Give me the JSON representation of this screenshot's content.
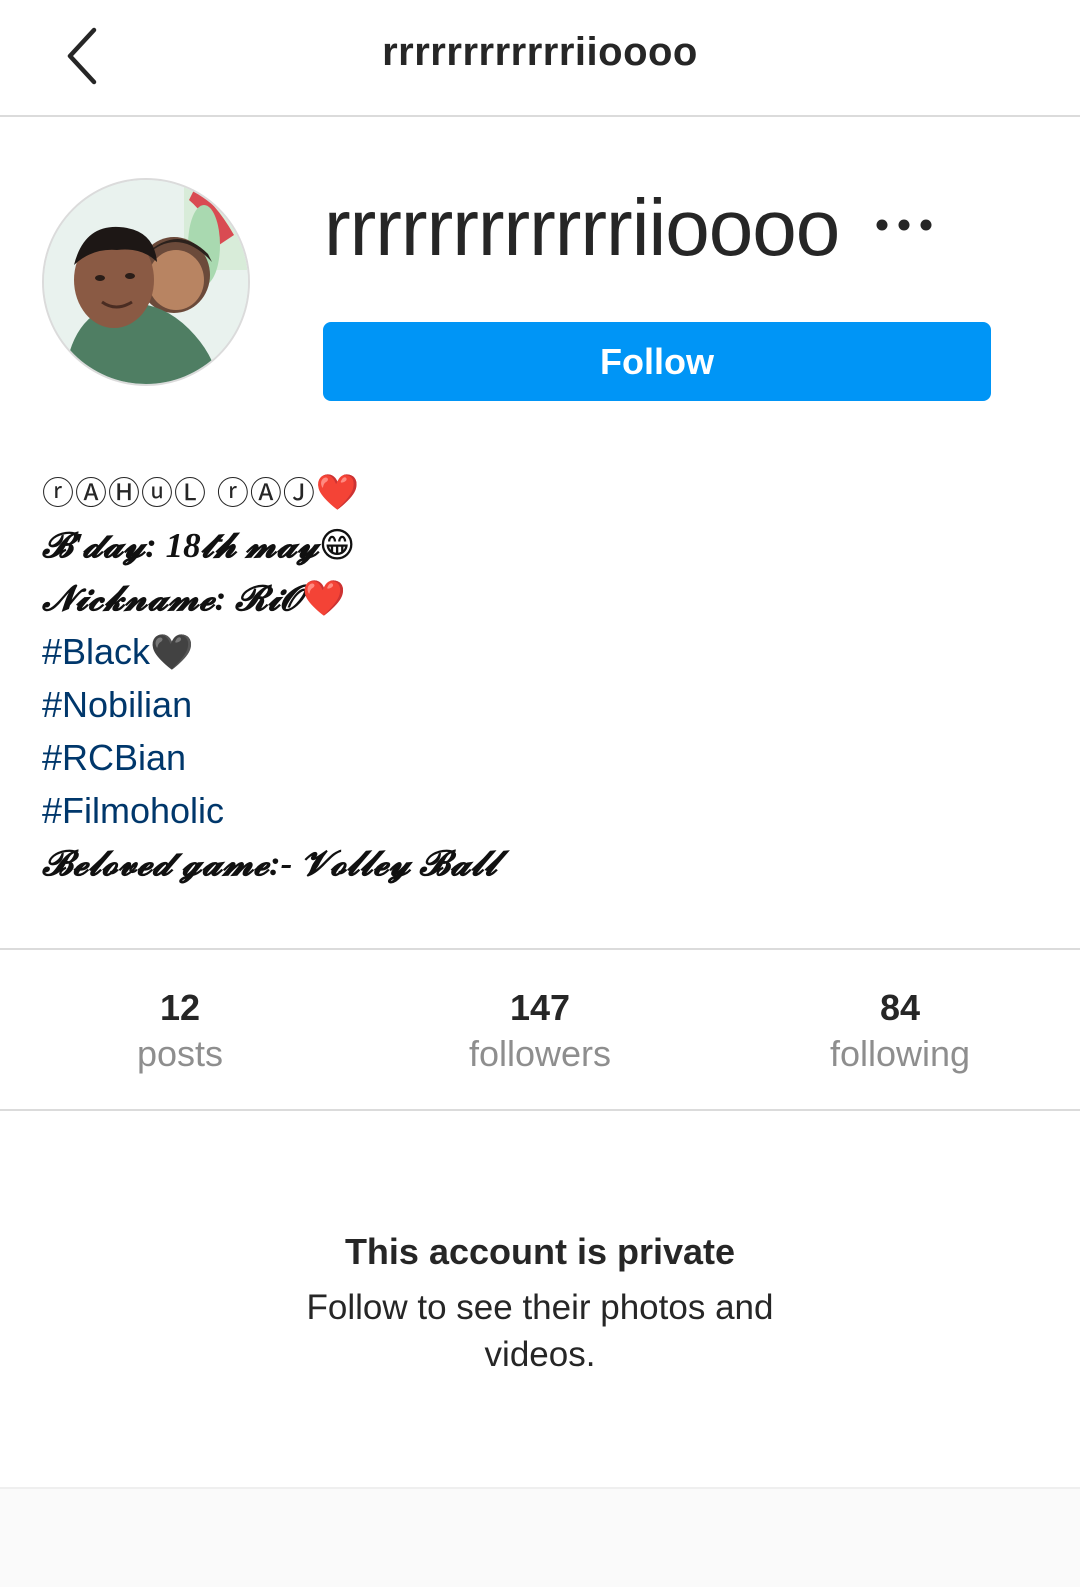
{
  "header": {
    "title": "rrrrrrrrrrrriioooo"
  },
  "profile": {
    "username": "rrrrrrrrrrrriioooo",
    "follow_label": "Follow"
  },
  "bio": {
    "line1_name": "ⓡⒶⒽⓤⓁ ⓡⒶⒿ",
    "line1_emoji": "❤️",
    "line2_text": "𝓑'𝓭𝓪𝔂: 18𝓽𝓱 𝓶𝓪𝔂",
    "line2_emoji": "😁",
    "line3_text": "𝓝𝓲𝓬𝓴𝓷𝓪𝓶𝓮: 𝓡𝓲𝓞",
    "line3_emoji": "❤️",
    "hashtags": [
      "#Black",
      "#Nobilian",
      "#RCBian",
      "#Filmoholic"
    ],
    "black_heart": "🖤",
    "line8_text": "𝓑𝓮𝓵𝓸𝓿𝓮𝓭 𝓰𝓪𝓶𝓮:- 𝓥𝓸𝓵𝓵𝓮𝔂 𝓑𝓪𝓵𝓵"
  },
  "stats": [
    {
      "value": "12",
      "label": "posts"
    },
    {
      "value": "147",
      "label": "followers"
    },
    {
      "value": "84",
      "label": "following"
    }
  ],
  "private_notice": {
    "title": "This account is private",
    "subtitle": "Follow to see their photos and videos."
  },
  "colors": {
    "accent": "#0095f6",
    "hashtag": "#00376b",
    "muted": "#8e8e8e",
    "divider": "#dbdbdb"
  },
  "icons": {
    "back": "chevron-left-icon",
    "more": "more-horizontal-icon"
  }
}
